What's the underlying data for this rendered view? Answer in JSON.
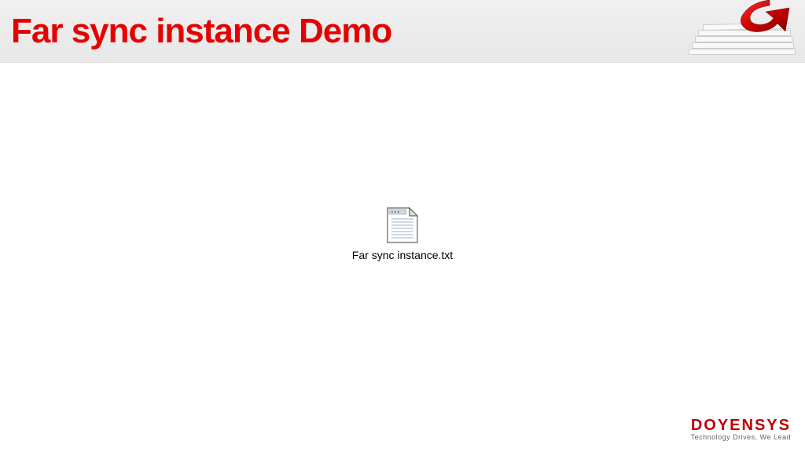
{
  "header": {
    "title": "Far sync instance Demo"
  },
  "file": {
    "name": "Far sync instance.txt"
  },
  "footer": {
    "company": "DOYENSYS",
    "tagline": "Technology Drives, We Lead"
  }
}
